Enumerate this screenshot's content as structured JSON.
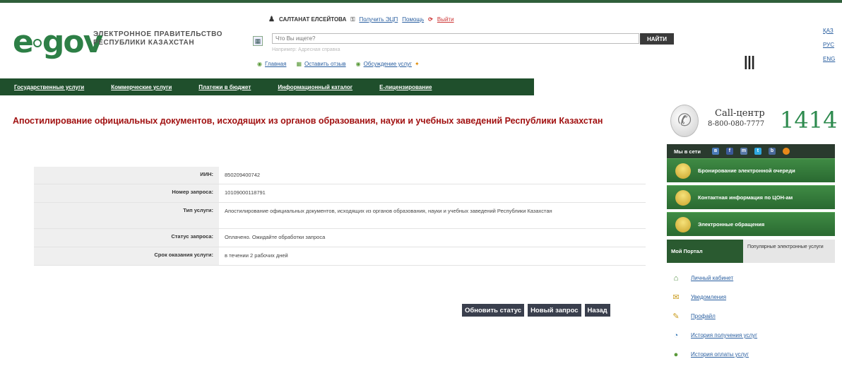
{
  "header": {
    "logo": {
      "e": "e",
      "gov": "gov"
    },
    "brand_line1": "ЭЛЕКТРОННОЕ ПРАВИТЕЛЬСТВО",
    "brand_line2": "РЕСПУБЛИКИ КАЗАХСТАН",
    "user_name": "САЛТАНАТ ЕЛСЕЙТОВА",
    "get_eds": "Получить ЭЦП",
    "help": "Помощь",
    "logout": "Выйти",
    "search_placeholder": "Что Вы ищете?",
    "search_button": "НАЙТИ",
    "search_hint": "Например: Адресная справка",
    "subnav": [
      "Главная",
      "Оставить отзыв",
      "Обсуждение услуг"
    ],
    "langs": [
      "ҚАЗ",
      "РУС",
      "ENG"
    ]
  },
  "nav": [
    "Государственные услуги",
    "Коммерческие услуги",
    "Платежи в бюджет",
    "Информационный каталог",
    "Е-лицензирование"
  ],
  "page_title": "Апостилирование официальных документов, исходящих из органов образования, науки и учебных заведений Республики Казахстан",
  "details": [
    {
      "label": "ИИН:",
      "value": "850209400742"
    },
    {
      "label": "Номер запроса:",
      "value": "10109000118791"
    },
    {
      "label": "Тип услуги:",
      "value": "Апостилирование официальных документов, исходящих из органов образования, науки и учебных заведений Республики Казахстан"
    },
    {
      "label": "Статус запроса:",
      "value": "Оплачено. Ожидайте обработки запроса"
    },
    {
      "label": "Срок оказания услуги:",
      "value": "в течении 2 рабочих дней"
    }
  ],
  "buttons": {
    "refresh": "Обновить статус",
    "new_request": "Новый запрос",
    "back": "Назад"
  },
  "sidebar": {
    "call_label": "Call-центр",
    "call_phone": "8-800-080-7777",
    "call_number": "1414",
    "social_label": "Мы в сети",
    "green_buttons": [
      "Бронирование электронной очереди",
      "Контактная информация по ЦОН-ам",
      "Электронные обращения"
    ],
    "tab_my_portal": "Мой Портал",
    "tab_popular": "Популярные электронные услуги",
    "menu": [
      "Личный кабинет",
      "Уведомления",
      "Профайл",
      "История получения услуг",
      "История оплаты услуг"
    ]
  }
}
